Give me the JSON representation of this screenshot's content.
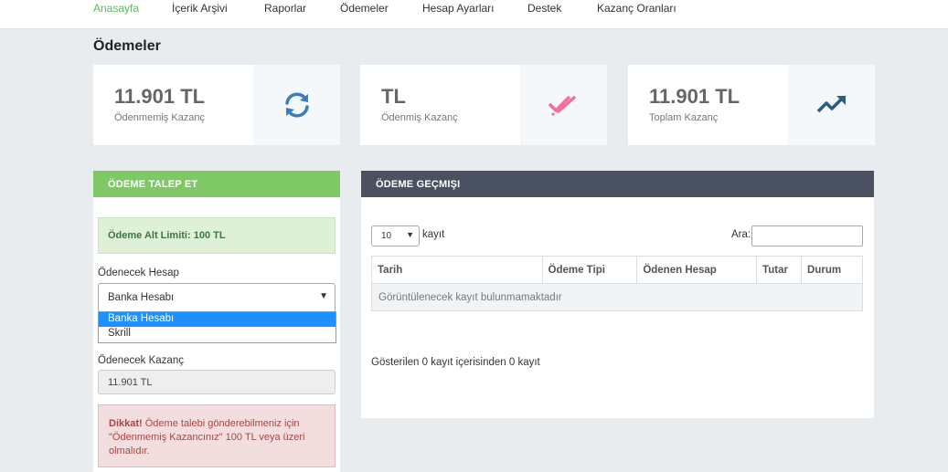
{
  "nav": {
    "items": [
      "Anasayfa",
      "İçerik Arşivi",
      "Raporlar",
      "Ödemeler",
      "Hesap Ayarları",
      "Destek",
      "Kazanç Oranları"
    ],
    "active_color": "#5cb85c"
  },
  "page": {
    "title": "Ödemeler"
  },
  "stats": [
    {
      "value": "11.901 TL",
      "label": "Ödenmemiş Kazanç",
      "icon": "refresh-icon",
      "color": "#3a7dbf"
    },
    {
      "value": "TL",
      "label": "Ödenmiş Kazanç",
      "icon": "double-check-icon",
      "color": "#f0709a"
    },
    {
      "value": "11.901 TL",
      "label": "Toplam Kazanç",
      "icon": "trending-up-icon",
      "color": "#2b5d7e"
    }
  ],
  "request_panel": {
    "header": "ÖDEME TALEP ET",
    "header_color": "#7ec865",
    "limit_text": "Ödeme Alt Limiti: 100 TL",
    "account_label": "Ödenecek Hesap",
    "account_selected": "Banka Hesabı",
    "account_options": [
      "Banka Hesabı",
      "Skrill"
    ],
    "amount_label": "Ödenecek Kazanç",
    "amount_value": "11.901 TL",
    "warning_title": "Dikkat!",
    "warning_text": " Ödeme talebi gönderebilmeniz için \"Ödenmemiş Kazancınız\" 100 TL veya üzeri olmalıdır."
  },
  "history_panel": {
    "header": "ÖDEME GEÇMIŞI",
    "header_color": "#4a5160",
    "length_value": "10",
    "length_label": "kayıt",
    "search_label": "Ara:",
    "columns": [
      "Tarih",
      "Ödeme Tipi",
      "Ödenen Hesap",
      "Tutar",
      "Durum"
    ],
    "empty_text": "Görüntülenecek kayıt bulunmamaktadır",
    "info_text": "Gösterilen 0 kayıt içerisinden 0 kayıt"
  }
}
